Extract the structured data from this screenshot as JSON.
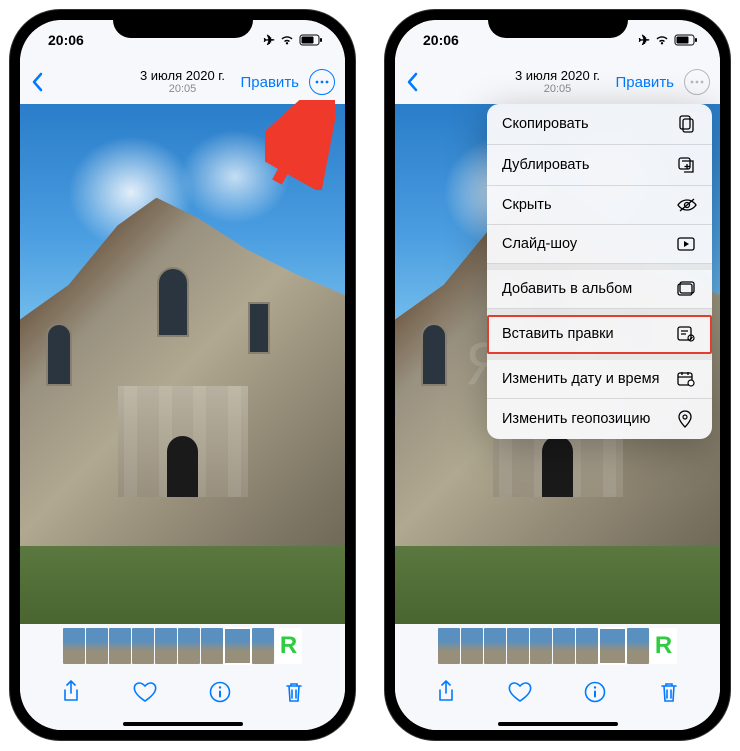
{
  "status": {
    "time": "20:06"
  },
  "nav": {
    "date": "3 июля 2020 г.",
    "time": "20:05",
    "edit": "Править"
  },
  "menu": {
    "copy": "Скопировать",
    "duplicate": "Дублировать",
    "hide": "Скрыть",
    "slideshow": "Слайд-шоу",
    "add_to_album": "Добавить в альбом",
    "paste_edits": "Вставить правки",
    "change_datetime": "Изменить дату и время",
    "change_location": "Изменить геопозицию"
  },
  "watermark": "Яблык",
  "thumb_logo": "Я"
}
